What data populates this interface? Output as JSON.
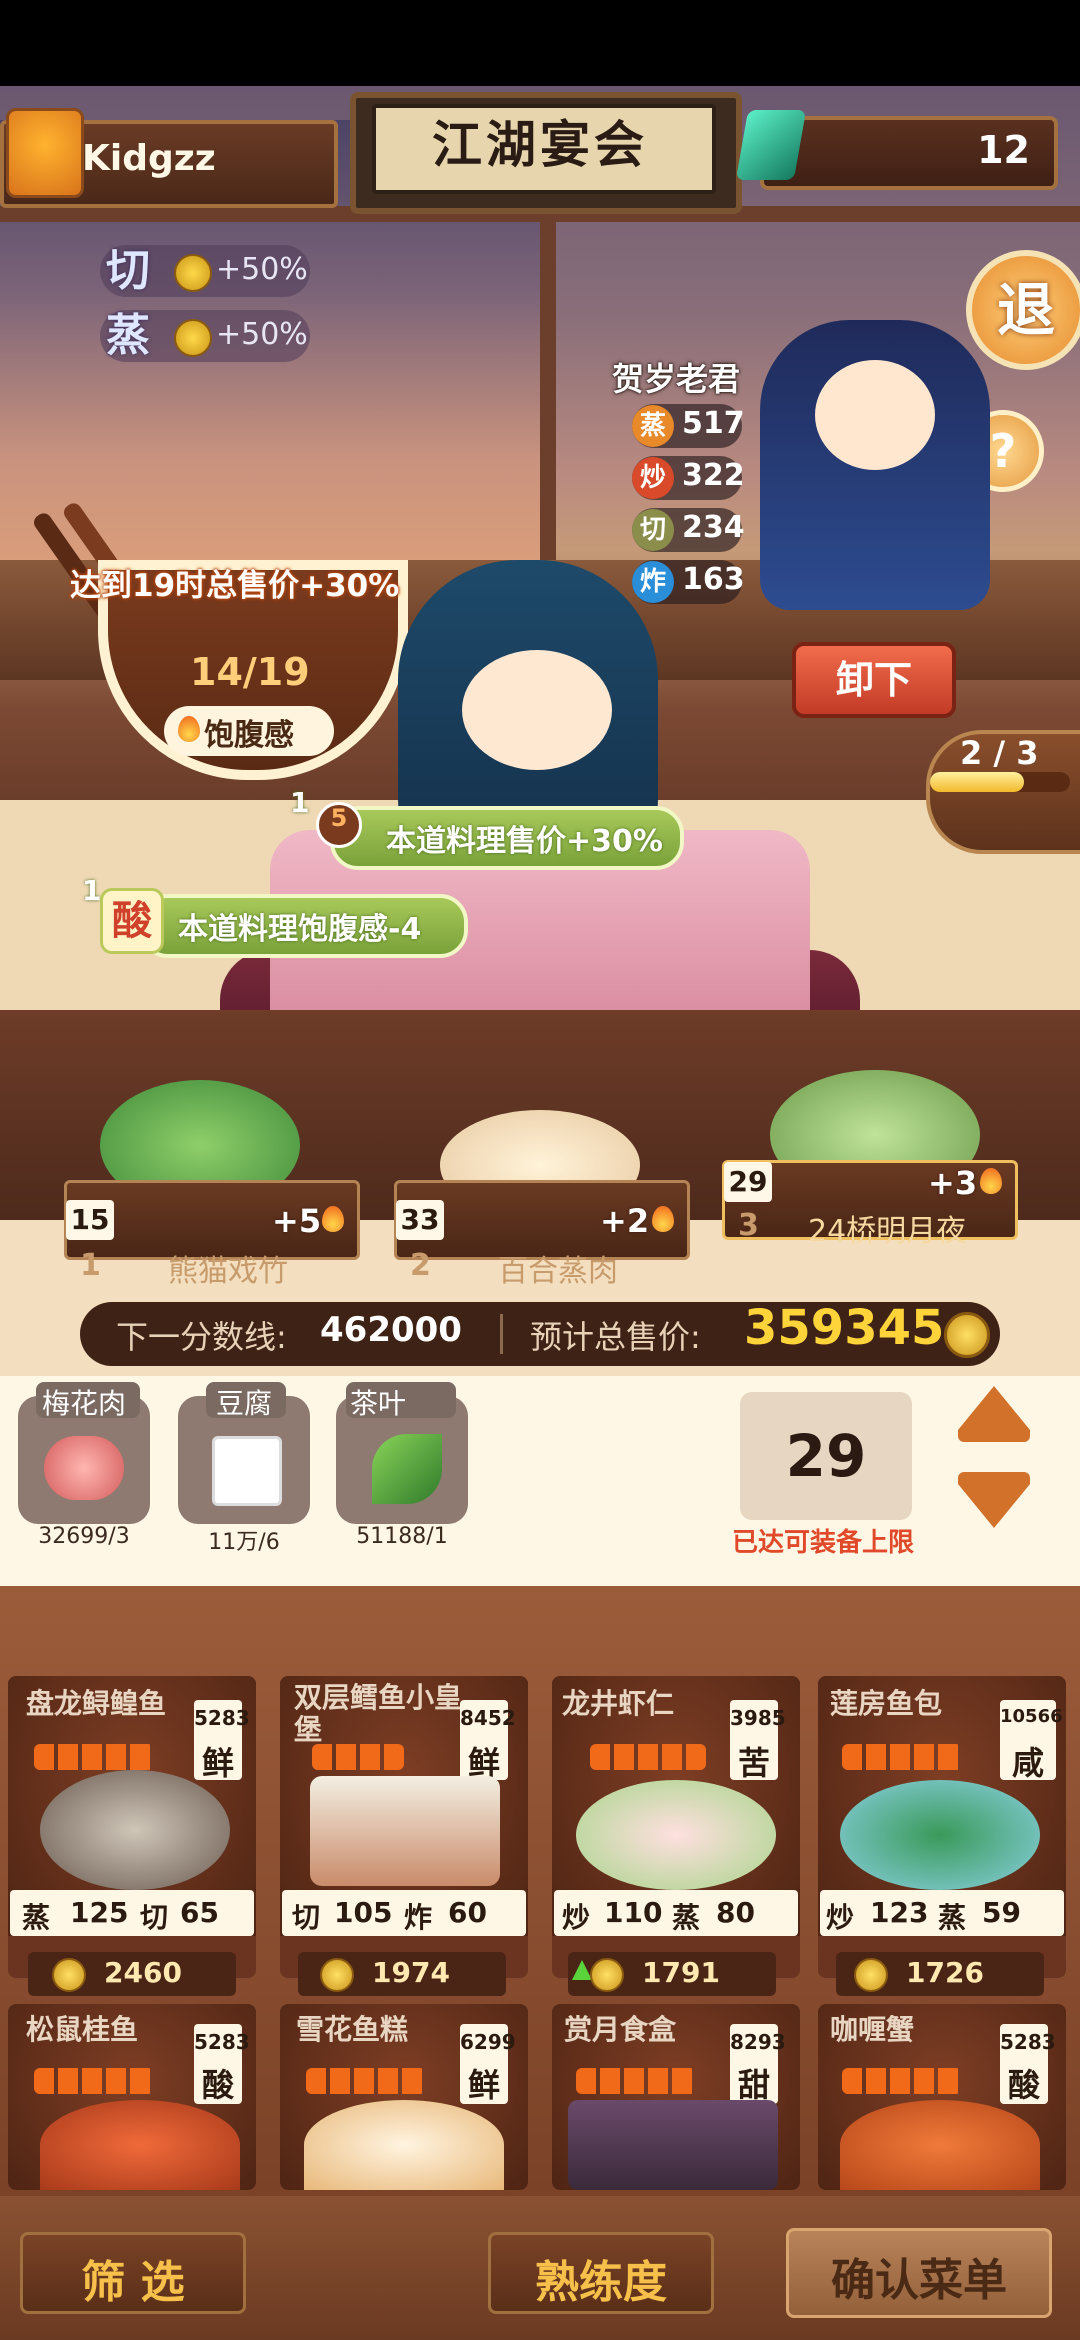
{
  "header": {
    "player_name": "Kidgzz",
    "game_title": "江湖宴会",
    "gem_count": "12"
  },
  "bonuses": [
    {
      "skill": "切",
      "value": "+50%"
    },
    {
      "skill": "蒸",
      "value": "+50%"
    }
  ],
  "guest": {
    "name": "贺岁老君",
    "stats": [
      {
        "skill": "蒸",
        "value": "517",
        "color": "#e8892a"
      },
      {
        "skill": "炒",
        "value": "322",
        "color": "#d84a2a"
      },
      {
        "skill": "切",
        "value": "234",
        "color": "#8a8e4a"
      },
      {
        "skill": "炸",
        "value": "163",
        "color": "#2a8ed8"
      }
    ]
  },
  "buttons": {
    "exit": "退",
    "help": "?",
    "unload": "卸下"
  },
  "progress": {
    "text": "2 / 3",
    "fraction": 0.67
  },
  "satiety": {
    "bonus_text": "达到19时总售价+30%",
    "count": "14/19",
    "label": "饱腹感"
  },
  "tags": [
    {
      "count": "1",
      "symbol": "5",
      "text": "本道料理售价+30%"
    },
    {
      "count": "1",
      "symbol": "酸",
      "text": "本道料理饱腹感-4"
    }
  ],
  "slots": [
    {
      "count": "15",
      "index": "1",
      "name": "熊猫戏竹",
      "plus": "+5"
    },
    {
      "count": "33",
      "index": "2",
      "name": "百合蒸肉",
      "plus": "+2"
    },
    {
      "count": "29",
      "index": "3",
      "name": "24桥明月夜",
      "plus": "+3"
    }
  ],
  "score": {
    "next_label": "下一分数线:",
    "next_value": "462000",
    "total_label": "预计总售价:",
    "total_value": "359345"
  },
  "ingredients": [
    {
      "name": "梅花肉",
      "count": "32699/3"
    },
    {
      "name": "豆腐",
      "count": "11万/6"
    },
    {
      "name": "茶叶",
      "count": "51188/1"
    }
  ],
  "quantity": {
    "value": "29",
    "note": "已达可装备上限"
  },
  "recipes": [
    {
      "name": "盘龙鲟鳇鱼",
      "price": "5283",
      "flavor": "鲜",
      "stats": [
        "蒸",
        "125",
        "切",
        "65"
      ],
      "coin": "2460",
      "up": false
    },
    {
      "name": "双层鳕鱼小皇堡",
      "price": "8452",
      "flavor": "鲜",
      "stats": [
        "切",
        "105",
        "炸",
        "60"
      ],
      "coin": "1974",
      "up": false
    },
    {
      "name": "龙井虾仁",
      "price": "3985",
      "flavor": "苦",
      "stats": [
        "炒",
        "110",
        "蒸",
        "80"
      ],
      "coin": "1791",
      "up": true
    },
    {
      "name": "莲房鱼包",
      "price": "10566",
      "flavor": "咸",
      "stats": [
        "炒",
        "123",
        "蒸",
        "59"
      ],
      "coin": "1726",
      "up": false
    },
    {
      "name": "松鼠桂鱼",
      "price": "5283",
      "flavor": "酸"
    },
    {
      "name": "雪花鱼糕",
      "price": "6299",
      "flavor": "鲜"
    },
    {
      "name": "赏月食盒",
      "price": "8293",
      "flavor": "甜"
    },
    {
      "name": "咖喱蟹",
      "price": "5283",
      "flavor": "酸"
    }
  ],
  "bottom": {
    "filter": "筛 选",
    "proficiency": "熟练度",
    "confirm": "确认菜单"
  }
}
